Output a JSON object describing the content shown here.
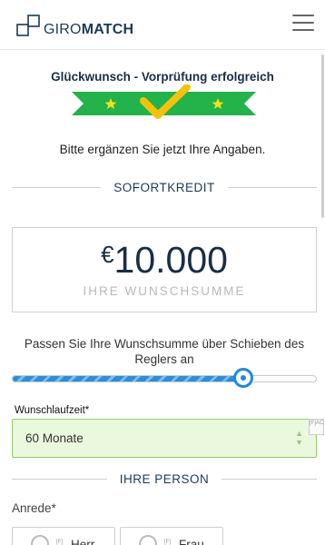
{
  "header": {
    "logo_giro": "GIRO",
    "logo_match": "MATCH"
  },
  "congrats": {
    "title": "Glückwunsch - Vorprüfung erfolgreich",
    "subtitle": "Bitte ergänzen Sie jetzt Ihre Angaben."
  },
  "sections": {
    "sofortkredit": "SOFORTKREDIT",
    "person": "IHRE PERSON"
  },
  "amount": {
    "currency": "€",
    "value": "10.000",
    "caption": "IHRE WUNSCHSUMME"
  },
  "slider": {
    "text": "Passen Sie Ihre Wunschsumme über Schieben des Reglers an",
    "fraction": 0.76
  },
  "laufzeit": {
    "label": "Wunschlaufzeit*",
    "value": "60 Monate",
    "autofill_badge": "[F]AC"
  },
  "anrede": {
    "label": "Anrede*",
    "options": [
      {
        "tag": "[F]",
        "label": "Herr"
      },
      {
        "tag": "[F]",
        "label": "Frau"
      }
    ]
  },
  "colors": {
    "brand_dark": "#1a3a57",
    "ribbon_green": "#24b24a",
    "check_yellow": "#f4c20d",
    "slider_blue": "#1f8ad6",
    "valid_green_bg": "#eaf8de",
    "valid_green_border": "#8fd06b"
  },
  "icons": {
    "logo": "giromatch-logo-icon",
    "menu": "hamburger-menu-icon",
    "check": "checkmark-icon",
    "stars": "star-icon",
    "select_arrows": "up-down-arrows-icon",
    "radio": "radio-circle-icon"
  }
}
